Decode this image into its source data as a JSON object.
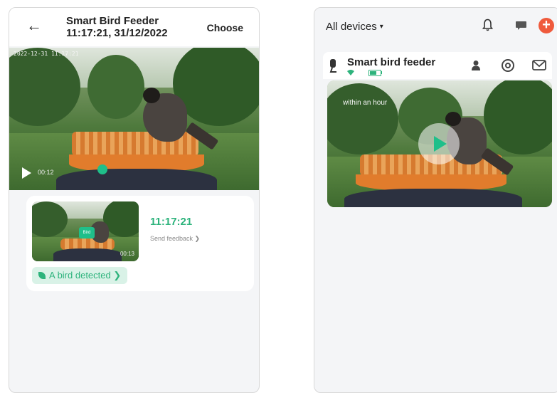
{
  "panel1": {
    "header": {
      "back_glyph": "←",
      "title": "Smart Bird Feeder",
      "subtitle": "11:17:21, 31/12/2022",
      "choose_label": "Choose"
    },
    "video": {
      "timestamp_overlay": "2022-12-31 11:17:21",
      "play_time": "00:12"
    },
    "event": {
      "thumb_tag": "Bird",
      "thumb_time": "00:13",
      "time": "11:17:21",
      "feedback_label": "Send feedback ❯",
      "chip_label": "A bird detected ❯"
    }
  },
  "panel2": {
    "header": {
      "devices_label": "All devices",
      "caret": "▾",
      "plus_glyph": "+"
    },
    "device": {
      "name": "Smart bird feeder",
      "overlay_text": "within an hour"
    }
  },
  "colors": {
    "accent": "#2db37c",
    "add_button": "#ef5a3c"
  }
}
